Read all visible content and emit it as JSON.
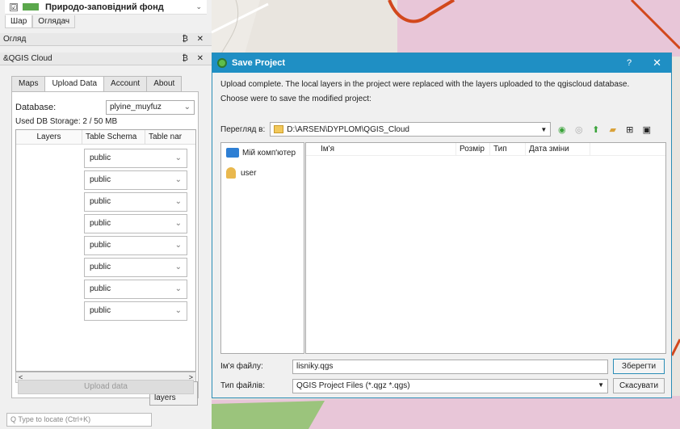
{
  "layers_panel": {
    "layer_label": "Природо-заповідний фонд",
    "checkbox_mark": "☑",
    "expand_glyph": "⌄"
  },
  "bottom_tabs": [
    "Шар",
    "Оглядач"
  ],
  "overview_dock": {
    "title": "Огляд",
    "buttons": "₿ ✕"
  },
  "cloud_dock": {
    "title": "&QGIS Cloud",
    "buttons": "₿ ✕"
  },
  "cloud_tabs": [
    "Maps",
    "Upload Data",
    "Account",
    "About"
  ],
  "database": {
    "label": "Database:",
    "value": "plyine_muyfuz"
  },
  "storage_text": "Used DB Storage: 2 / 50 MB",
  "layers_table": {
    "headers": [
      "Layers",
      "Table Schema",
      "Table nar"
    ],
    "schema_values": [
      "public",
      "public",
      "public",
      "public",
      "public",
      "public",
      "public",
      "public"
    ]
  },
  "refresh_label": "Refresh layers",
  "upload_label": "Upload data",
  "locate_placeholder": "Q  Type to locate (Ctrl+K)",
  "dialog": {
    "title": "Save Project",
    "help": "?",
    "close": "✕",
    "message1": "Upload complete. The local layers in the project were replaced with the layers uploaded to the qgiscloud database.",
    "message2": "Choose were to save the modified project:",
    "look_in_label": "Переглянути в:",
    "look_in_label_shown": "Перегляд в:",
    "path": "D:\\ARSEN\\DYPLOM\\QGIS_Cloud",
    "places": [
      "Мій комп'ютер",
      "user"
    ],
    "columns": [
      "Ім'я",
      "Розмір",
      "Тип",
      "Дата зміни"
    ],
    "filename_label": "Ім'я файлу:",
    "filename_value": "lisniky.qgs",
    "filetype_label": "Тип файлів:",
    "filetype_value": "QGIS Project Files (*.qgz *.qgs)",
    "save_label": "Зберегти",
    "cancel_label": "Скасувати"
  },
  "colors": {
    "title_bar": "#1f8fc4",
    "map_pink": "#e8c6d8",
    "road": "#d2481c",
    "forest": "#9bc47c"
  }
}
